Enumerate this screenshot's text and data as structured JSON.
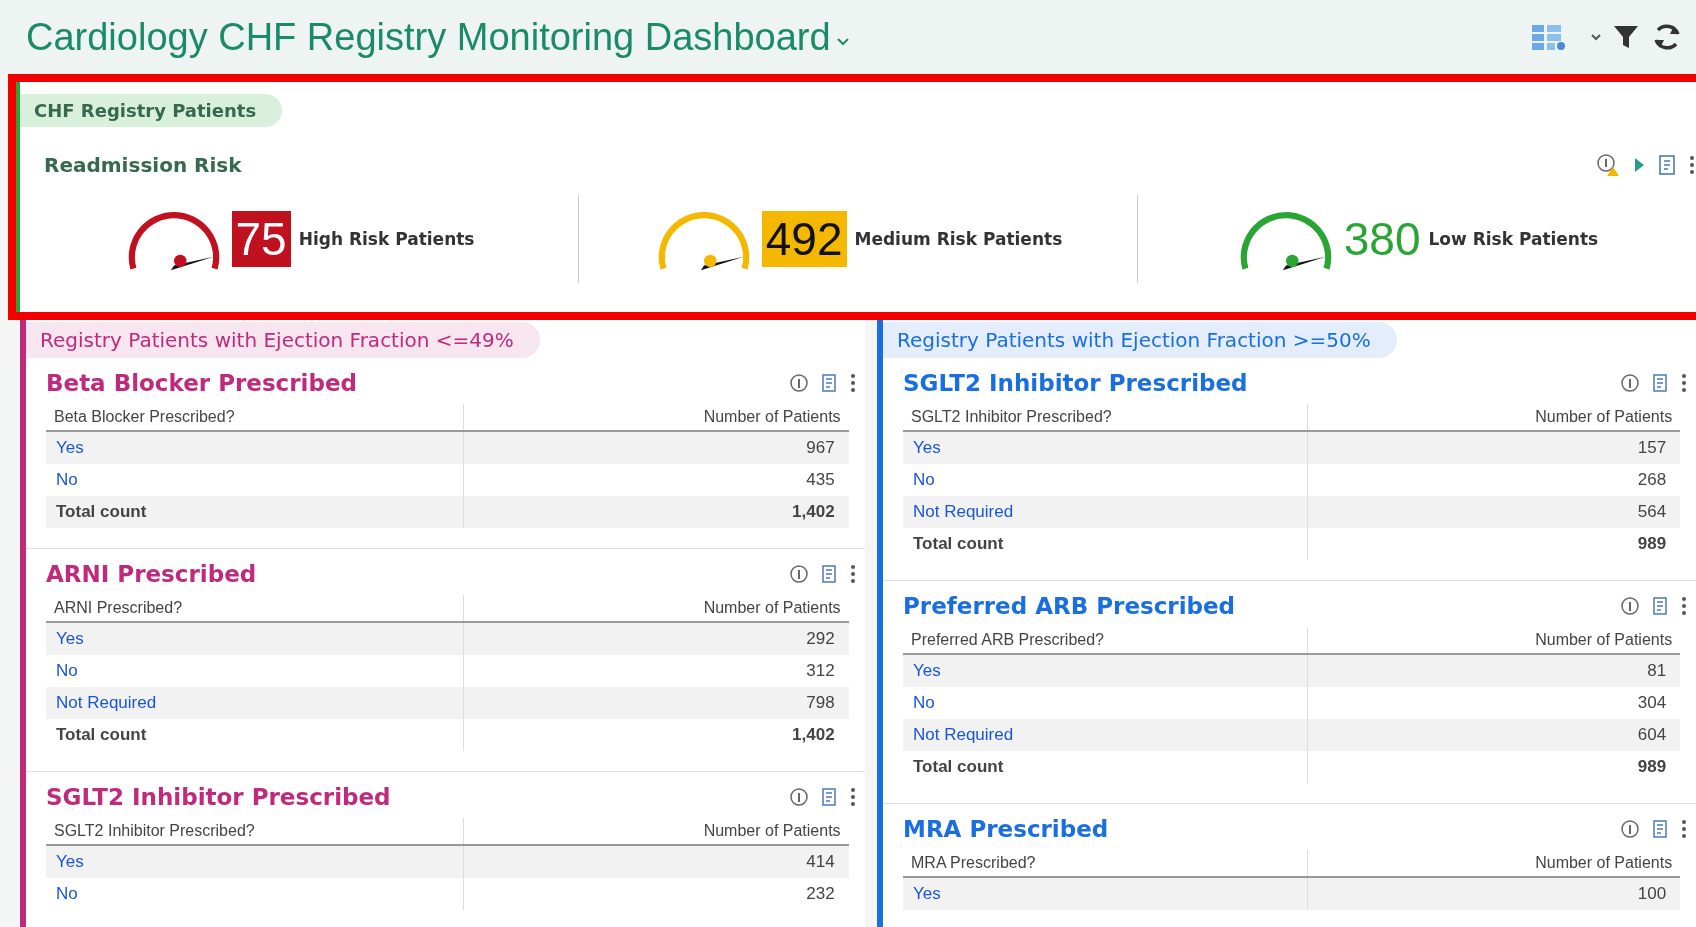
{
  "header": {
    "title": "Cardiology CHF Registry Monitoring Dashboard"
  },
  "risk_section": {
    "label": "CHF Registry Patients",
    "title": "Readmission Risk",
    "items": [
      {
        "value": "75",
        "label": "High Risk Patients",
        "color": "#c0111f",
        "badge_filled": true
      },
      {
        "value": "492",
        "label": "Medium Risk Patients",
        "color": "#f5b800",
        "badge_filled": true
      },
      {
        "value": "380",
        "label": "Low Risk Patients",
        "color": "#2aa534",
        "badge_filled": false
      }
    ]
  },
  "panels": [
    {
      "label": "Registry Patients with Ejection Fraction <=49%",
      "color": "#c02a7c",
      "cards": [
        {
          "title": "Beta Blocker Prescribed",
          "column_1": "Beta Blocker Prescribed?",
          "column_2": "Number of Patients",
          "rows": [
            {
              "kind": "value",
              "label": "Yes",
              "count": "967"
            },
            {
              "kind": "value",
              "label": "No",
              "count": "435"
            },
            {
              "kind": "total",
              "label": "Total count",
              "count": "1,402"
            }
          ]
        },
        {
          "title": "ARNI Prescribed",
          "column_1": "ARNI Prescribed?",
          "column_2": "Number of Patients",
          "rows": [
            {
              "kind": "value",
              "label": "Yes",
              "count": "292"
            },
            {
              "kind": "value",
              "label": "No",
              "count": "312"
            },
            {
              "kind": "value",
              "label": "Not Required",
              "count": "798"
            },
            {
              "kind": "total",
              "label": "Total count",
              "count": "1,402"
            }
          ]
        },
        {
          "title": "SGLT2 Inhibitor Prescribed",
          "column_1": "SGLT2 Inhibitor Prescribed?",
          "column_2": "Number of Patients",
          "rows": [
            {
              "kind": "value",
              "label": "Yes",
              "count": "414"
            },
            {
              "kind": "value",
              "label": "No",
              "count": "232"
            }
          ]
        }
      ]
    },
    {
      "label": "Registry Patients with Ejection Fraction >=50%",
      "color": "#1a6fe0",
      "cards": [
        {
          "title": "SGLT2 Inhibitor Prescribed",
          "column_1": "SGLT2 Inhibitor Prescribed?",
          "column_2": "Number of Patients",
          "rows": [
            {
              "kind": "value",
              "label": "Yes",
              "count": "157"
            },
            {
              "kind": "value",
              "label": "No",
              "count": "268"
            },
            {
              "kind": "value",
              "label": "Not Required",
              "count": "564"
            },
            {
              "kind": "total",
              "label": "Total count",
              "count": "989"
            }
          ]
        },
        {
          "title": "Preferred ARB Prescribed",
          "column_1": "Preferred ARB Prescribed?",
          "column_2": "Number of Patients",
          "rows": [
            {
              "kind": "value",
              "label": "Yes",
              "count": "81"
            },
            {
              "kind": "value",
              "label": "No",
              "count": "304"
            },
            {
              "kind": "value",
              "label": "Not Required",
              "count": "604"
            },
            {
              "kind": "total",
              "label": "Total count",
              "count": "989"
            }
          ]
        },
        {
          "title": "MRA Prescribed",
          "column_1": "MRA Prescribed?",
          "column_2": "Number of Patients",
          "rows": [
            {
              "kind": "value",
              "label": "Yes",
              "count": "100"
            }
          ]
        }
      ]
    }
  ]
}
